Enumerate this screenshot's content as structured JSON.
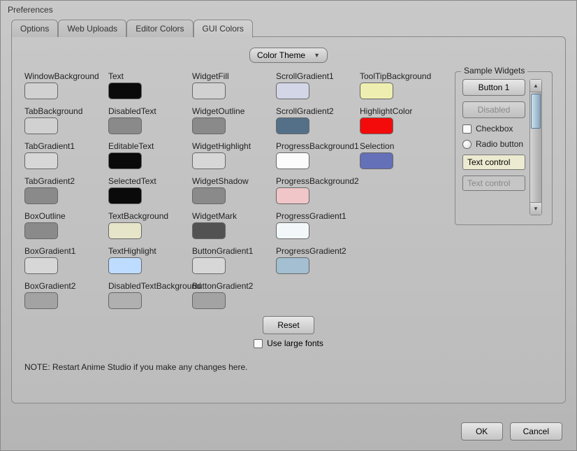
{
  "window": {
    "title": "Preferences"
  },
  "tabs": [
    {
      "label": "Options"
    },
    {
      "label": "Web Uploads"
    },
    {
      "label": "Editor Colors"
    },
    {
      "label": "GUI Colors"
    }
  ],
  "active_tab": 3,
  "theme_dropdown": {
    "label": "Color Theme"
  },
  "swatches": [
    {
      "label": "WindowBackground",
      "color": "#d1d1d1"
    },
    {
      "label": "Text",
      "color": "#0a0a0a"
    },
    {
      "label": "WidgetFill",
      "color": "#d1d1d1"
    },
    {
      "label": "ScrollGradient1",
      "color": "#d2d6e6"
    },
    {
      "label": "ToolTipBackground",
      "color": "#eeeeb0"
    },
    {
      "label": "TabBackground",
      "color": "#d1d1d1"
    },
    {
      "label": "DisabledText",
      "color": "#8a8a8a"
    },
    {
      "label": "WidgetOutline",
      "color": "#8a8a8a"
    },
    {
      "label": "ScrollGradient2",
      "color": "#547089"
    },
    {
      "label": "HighlightColor",
      "color": "#f30b0b"
    },
    {
      "label": "TabGradient1",
      "color": "#d7d7d7"
    },
    {
      "label": "EditableText",
      "color": "#0a0a0a"
    },
    {
      "label": "WidgetHighlight",
      "color": "#d7d7d7"
    },
    {
      "label": "ProgressBackground1",
      "color": "#fbfbfb"
    },
    {
      "label": "Selection",
      "color": "#6470b8"
    },
    {
      "label": "TabGradient2",
      "color": "#8a8a8a"
    },
    {
      "label": "SelectedText",
      "color": "#0a0a0a"
    },
    {
      "label": "WidgetShadow",
      "color": "#8a8a8a"
    },
    {
      "label": "ProgressBackground2",
      "color": "#f0c6c8"
    },
    {
      "label": "",
      "color": ""
    },
    {
      "label": "BoxOutline",
      "color": "#8a8a8a"
    },
    {
      "label": "TextBackground",
      "color": "#e7e5c9"
    },
    {
      "label": "WidgetMark",
      "color": "#525252"
    },
    {
      "label": "ProgressGradient1",
      "color": "#f2f7fa"
    },
    {
      "label": "",
      "color": ""
    },
    {
      "label": "BoxGradient1",
      "color": "#d7d7d7"
    },
    {
      "label": "TextHighlight",
      "color": "#bedcff"
    },
    {
      "label": "ButtonGradient1",
      "color": "#d7d7d7"
    },
    {
      "label": "ProgressGradient2",
      "color": "#a3bfd1"
    },
    {
      "label": "",
      "color": ""
    },
    {
      "label": "BoxGradient2",
      "color": "#a3a3a3"
    },
    {
      "label": "DisabledTextBackground",
      "color": "#b0b0b0"
    },
    {
      "label": "ButtonGradient2",
      "color": "#a3a3a3"
    }
  ],
  "sample": {
    "legend": "Sample Widgets",
    "button1": "Button 1",
    "disabled_btn": "Disabled",
    "checkbox": "Checkbox",
    "radio": "Radio button",
    "text_control": "Text control",
    "text_control_dis": "Text control"
  },
  "reset_label": "Reset",
  "large_fonts_label": "Use large fonts",
  "note": "NOTE: Restart Anime Studio if you make any changes here.",
  "footer": {
    "ok": "OK",
    "cancel": "Cancel"
  }
}
